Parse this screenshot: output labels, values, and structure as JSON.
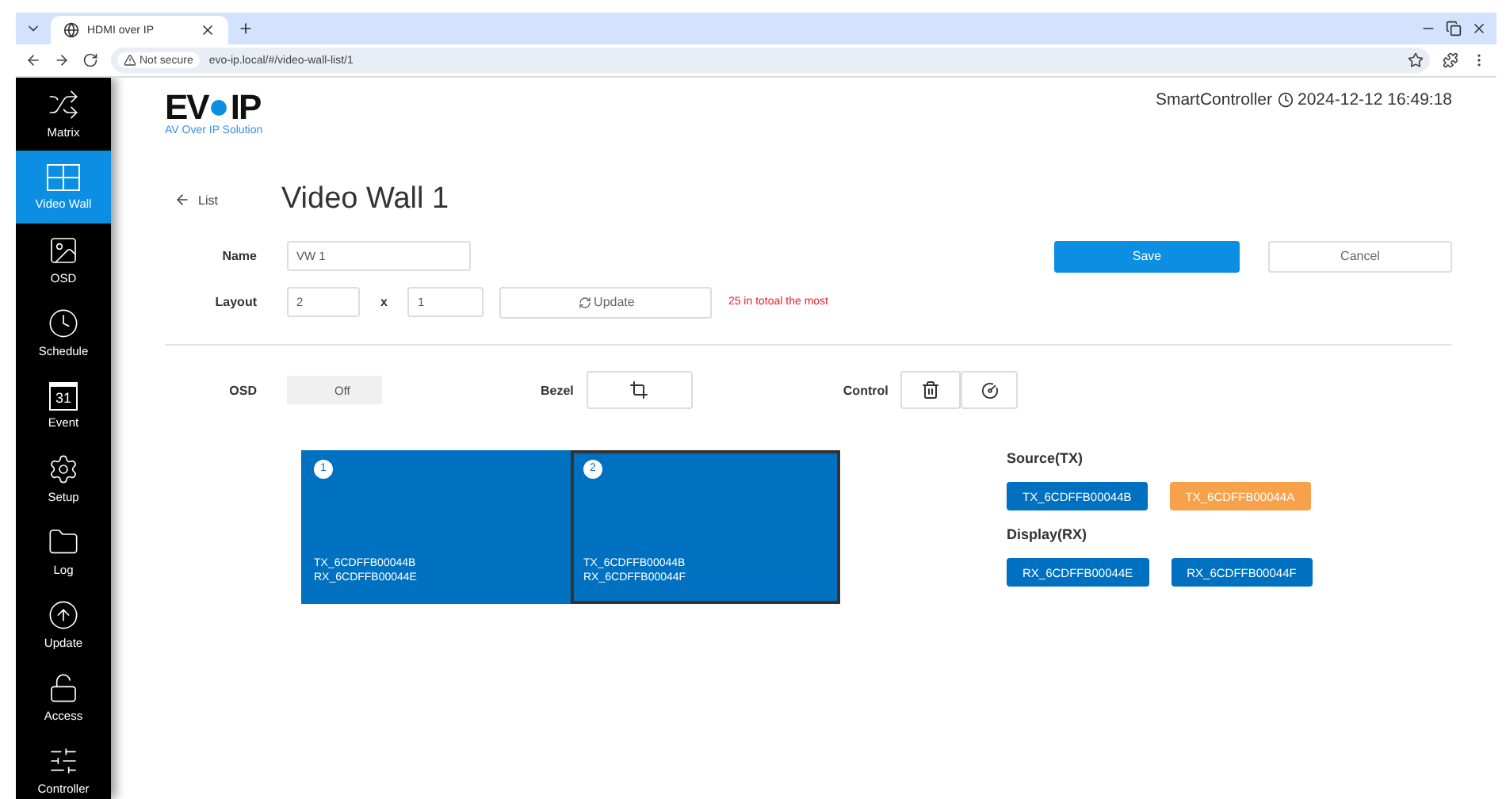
{
  "browser": {
    "tab_title": "HDMI over IP",
    "security": "Not secure",
    "url": "evo-ip.local/#/video-wall-list/1"
  },
  "sidebar": {
    "items": [
      {
        "kind": "matrix",
        "label": "Matrix",
        "selected": false
      },
      {
        "kind": "videowall",
        "label": "Video Wall",
        "selected": true
      },
      {
        "kind": "osd",
        "label": "OSD",
        "selected": false
      },
      {
        "kind": "schedule",
        "label": "Schedule",
        "selected": false
      },
      {
        "kind": "event",
        "label": "Event",
        "selected": false,
        "icon_text": "31"
      },
      {
        "kind": "setup",
        "label": "Setup",
        "selected": false
      },
      {
        "kind": "log",
        "label": "Log",
        "selected": false
      },
      {
        "kind": "update",
        "label": "Update",
        "selected": false
      },
      {
        "kind": "access",
        "label": "Access",
        "selected": false
      },
      {
        "kind": "controller",
        "label": "Controller",
        "selected": false
      }
    ]
  },
  "logo": {
    "brand_left": "EV",
    "brand_right": "IP",
    "tagline": "AV Over IP Solution"
  },
  "header": {
    "device": "SmartController",
    "datetime": "2024-12-12 16:49:18"
  },
  "back_link": "List",
  "title": "Video Wall 1",
  "form": {
    "name_label": "Name",
    "name_value": "VW 1",
    "layout_label": "Layout",
    "cols": "2",
    "times": "x",
    "rows": "1",
    "update_button": "Update",
    "hint": "25 in totoal the most",
    "save": "Save",
    "cancel": "Cancel"
  },
  "options": {
    "osd_label": "OSD",
    "osd_on": false,
    "osd_state": "Off",
    "bezel_label": "Bezel",
    "control_label": "Control"
  },
  "wall": [
    {
      "number": "1",
      "tx": "TX_6CDFFB00044B",
      "rx": "RX_6CDFFB00044E",
      "selected": false
    },
    {
      "number": "2",
      "tx": "TX_6CDFFB00044B",
      "rx": "RX_6CDFFB00044F",
      "selected": true
    }
  ],
  "source": {
    "title": "Source(TX)",
    "items": [
      {
        "label": "TX_6CDFFB00044B",
        "color": "#0070c0"
      },
      {
        "label": "TX_6CDFFB00044A",
        "color": "#f7a24b"
      }
    ]
  },
  "display": {
    "title": "Display(RX)",
    "items": [
      {
        "label": "RX_6CDFFB00044E",
        "color": "#0070c0"
      },
      {
        "label": "RX_6CDFFB00044F",
        "color": "#0070c0"
      }
    ]
  }
}
